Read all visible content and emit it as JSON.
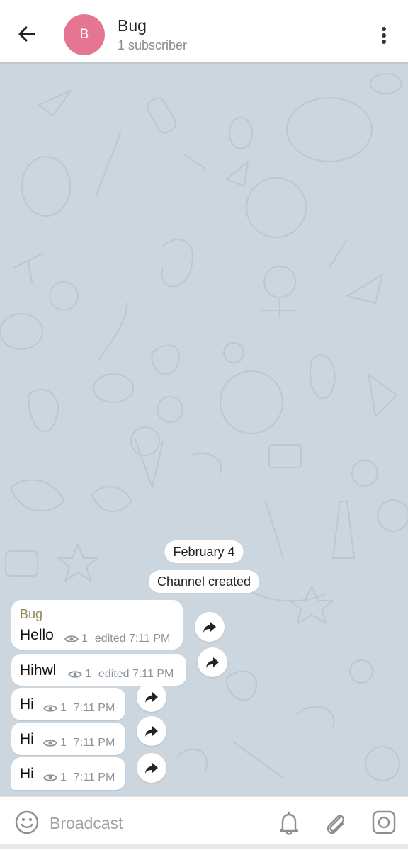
{
  "header": {
    "title": "Bug",
    "subtitle": "1 subscriber",
    "avatar_letter": "B",
    "avatar_color": "#e57591"
  },
  "chat": {
    "background_color": "#ccd6df",
    "date_label": "February 4",
    "service_message": "Channel created",
    "messages": [
      {
        "author": "Bug",
        "text": "Hello",
        "views": "1",
        "time": "edited 7:11 PM"
      },
      {
        "text": "Hihwl",
        "views": "1",
        "time": "edited 7:11 PM"
      },
      {
        "text": "Hi",
        "views": "1",
        "time": "7:11 PM"
      },
      {
        "text": "Hi",
        "views": "1",
        "time": "7:11 PM"
      },
      {
        "text": "Hi",
        "views": "1",
        "time": "7:11 PM"
      }
    ]
  },
  "input_bar": {
    "placeholder": "Broadcast"
  },
  "icons": {
    "back": "arrow-left-icon",
    "more": "more-vertical-icon",
    "views": "eye-icon",
    "forward": "share-arrow-icon",
    "emoji": "emoji-icon",
    "bell": "bell-icon",
    "attach": "paperclip-icon",
    "camera": "camera-icon"
  }
}
